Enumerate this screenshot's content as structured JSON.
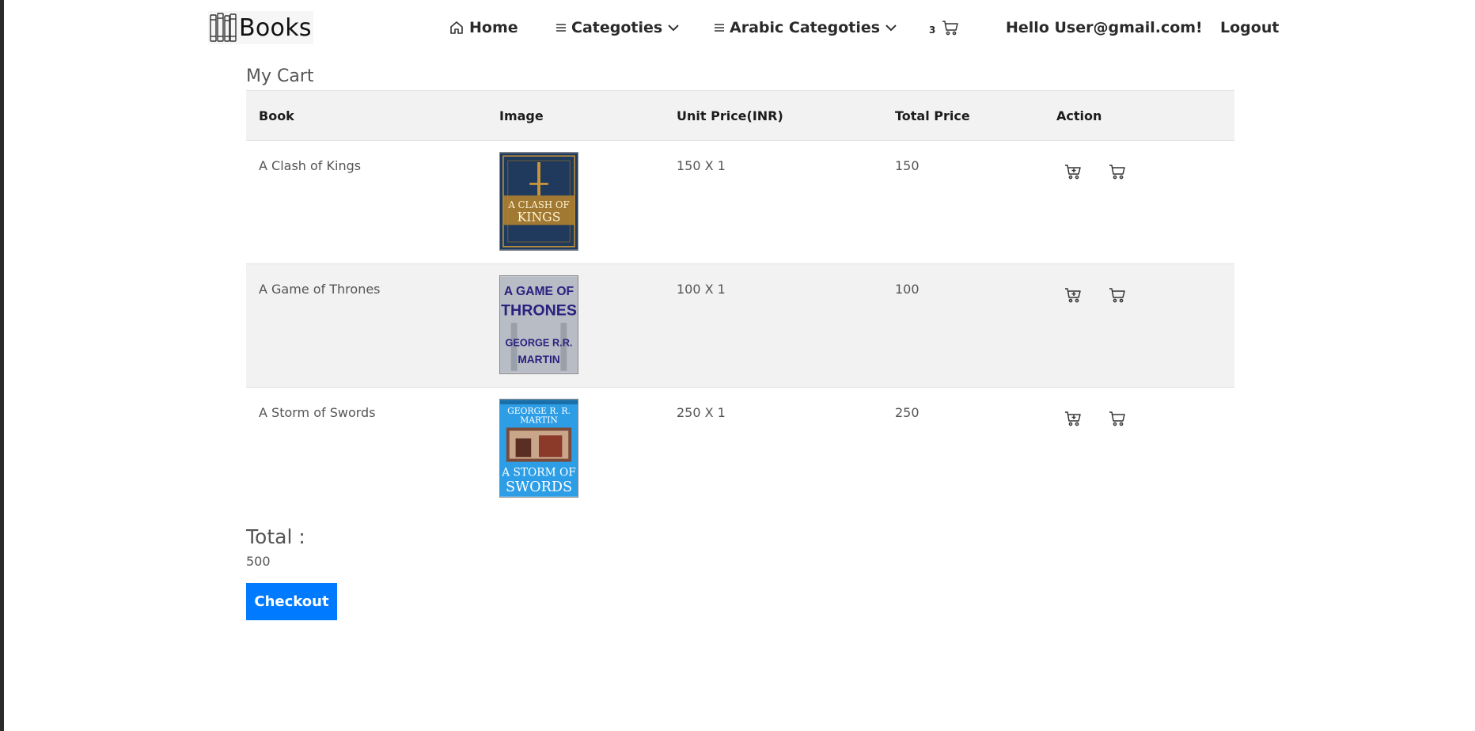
{
  "navbar": {
    "brand": "Books",
    "home": "Home",
    "categories": "Categoties",
    "arabic_categories": "Arabic Categoties",
    "cart_count": "3",
    "greeting": "Hello User@gmail.com!",
    "logout": "Logout"
  },
  "cart": {
    "title": "My Cart",
    "headers": {
      "book": "Book",
      "image": "Image",
      "unit_price": "Unit Price(INR)",
      "total_price": "Total Price",
      "action": "Action"
    },
    "rows": [
      {
        "book": "A Clash of Kings",
        "unit_price": "150 X 1",
        "total_price": "150",
        "cover": {
          "lines": [
            "A CLASH OF",
            "KINGS"
          ],
          "bg": "#1f3a5c",
          "accent": "#c8953a"
        }
      },
      {
        "book": "A Game of Thrones",
        "unit_price": "100 X 1",
        "total_price": "100",
        "cover": {
          "lines": [
            "A GAME OF",
            "THRONES",
            "GEORGE R.R.",
            "MARTIN"
          ],
          "bg": "#b8bcc4",
          "accent": "#2a2080"
        }
      },
      {
        "book": "A Storm of Swords",
        "unit_price": "250 X 1",
        "total_price": "250",
        "cover": {
          "lines": [
            "GEORGE R. R.",
            "MARTIN",
            "A STORM OF",
            "SWORDS"
          ],
          "bg": "#2d9ee6",
          "accent": "#ffffff"
        }
      }
    ],
    "total_label": "Total :",
    "total_value": "500",
    "checkout": "Checkout"
  },
  "colors": {
    "primary": "#007bff",
    "row_alt": "#f2f2f2"
  },
  "icons": [
    "books-logo-icon",
    "home-icon",
    "menu-icon",
    "chevron-down-icon",
    "cart-icon",
    "cart-add-icon"
  ]
}
